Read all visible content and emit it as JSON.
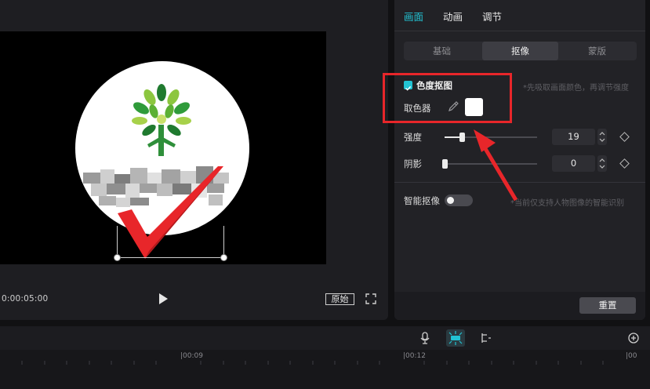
{
  "preview": {
    "timecode": "0:00:05:00",
    "ratio_label": "原始"
  },
  "right_panel": {
    "tabs": [
      "画面",
      "动画",
      "调节"
    ],
    "subtabs": [
      "基础",
      "抠像",
      "蒙版"
    ],
    "chroma_key": {
      "label": "色度抠图",
      "checked": true,
      "hint": "*先吸取画面颜色，再调节强度",
      "picker_label": "取色器",
      "picked_color": "#ffffff"
    },
    "intensity": {
      "label": "强度",
      "value": "19",
      "fraction": 0.19
    },
    "shadow": {
      "label": "阴影",
      "value": "0",
      "fraction": 0.0
    },
    "smart_key": {
      "label": "智能抠像",
      "enabled": false,
      "hint": "*当前仅支持人物图像的智能识别"
    },
    "reset_label": "重置"
  },
  "timeline": {
    "ruler_labels": [
      "|00:09",
      "|00:12",
      "|00"
    ]
  },
  "colors": {
    "accent": "#22c3d3",
    "highlight": "#e8262a"
  }
}
